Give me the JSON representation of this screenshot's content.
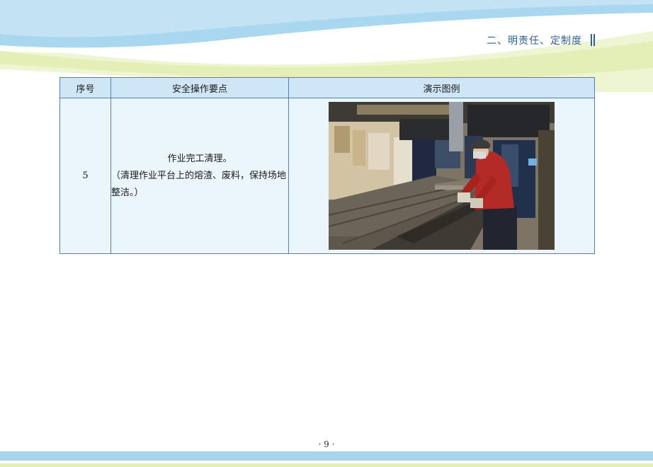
{
  "header": {
    "section_title": "二、明责任、定制度"
  },
  "table": {
    "columns": [
      "序号",
      "安全操作要点",
      "演示图例"
    ],
    "row": {
      "number": "5",
      "point_title": "作业完工清理。",
      "point_detail": "（清理作业平台上的熔渣、废料，保持场地整洁。）",
      "image_icon": "worker-cleaning-platform-photo"
    }
  },
  "footer": {
    "page_number": "· 9 ·"
  },
  "colors": {
    "header_blue": "#a9d7ef",
    "header_green": "#e4efb4",
    "title_blue": "#2f5f9e",
    "table_border": "#4a82c4",
    "table_header_bg": "#cfe6f6",
    "table_cell_bg": "#eaf5fc"
  }
}
